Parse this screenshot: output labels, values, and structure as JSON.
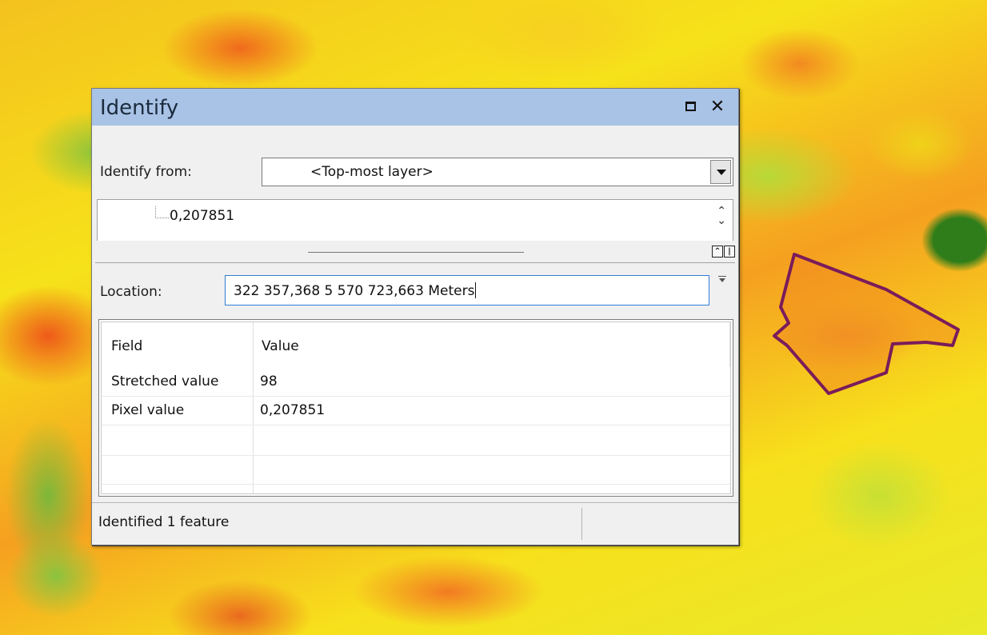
{
  "dialog": {
    "title": "Identify",
    "identify_from_label": "Identify from:",
    "identify_from_value": "<Top-most layer>",
    "tree_value": "0,207851",
    "location_label": "Location:",
    "location_value": "322 357,368  5 570 723,663 Meters",
    "table": {
      "columns": [
        "Field",
        "Value"
      ],
      "rows": [
        {
          "field": "Stretched value",
          "value": "98"
        },
        {
          "field": "Pixel value",
          "value": "0,207851"
        }
      ]
    },
    "status": "Identified 1 feature"
  },
  "colors": {
    "titlebar": "#a9c3e6",
    "polygon_outline": "#7a1c5a",
    "raster_low": "#2e7d1a",
    "raster_high": "#ee5a1a"
  },
  "icons": [
    "maximize-icon",
    "close-icon",
    "dropdown-arrow-icon",
    "scroll-icon",
    "collapse-icon",
    "split-icon"
  ]
}
